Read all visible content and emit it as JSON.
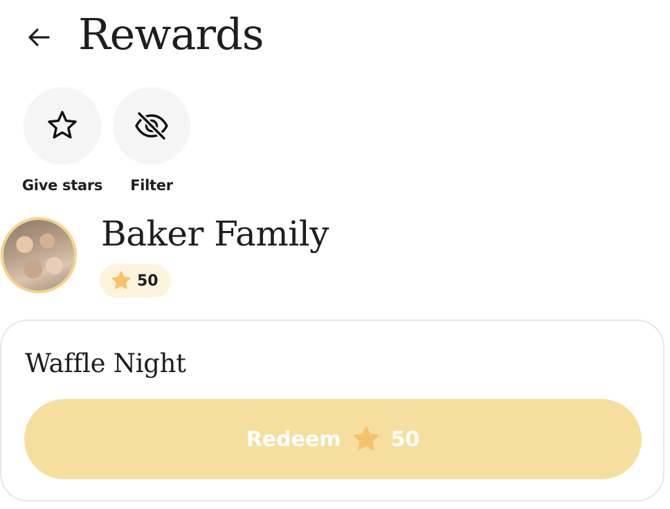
{
  "header": {
    "title": "Rewards",
    "back_icon": "arrow-left-icon"
  },
  "actions": [
    {
      "label": "Give stars",
      "icon": "star-outline-icon"
    },
    {
      "label": "Filter",
      "icon": "eye-off-icon"
    }
  ],
  "profile": {
    "name": "Baker Family",
    "stars": "50",
    "star_color": "#f6c36b",
    "badge_background": "#fdf4dd",
    "avatar_border": "#f3d48a"
  },
  "reward": {
    "title": "Waffle Night",
    "redeem_label": "Redeem",
    "cost": "50",
    "button_color": "#f6df9e"
  }
}
